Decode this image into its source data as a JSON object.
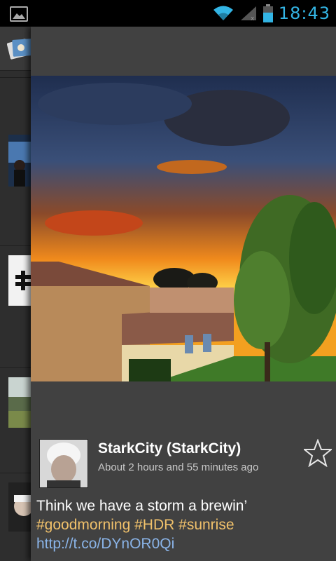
{
  "status_bar": {
    "time": "18:43",
    "icons": [
      "gallery-icon",
      "wifi-icon",
      "signal-icon",
      "battery-icon"
    ],
    "accent_color": "#33b5e5"
  },
  "sidebar": {
    "items": [
      {
        "type": "app-icon"
      },
      {
        "type": "thumbnail"
      },
      {
        "type": "thumbnail"
      },
      {
        "type": "thumbnail"
      },
      {
        "type": "thumbnail"
      }
    ]
  },
  "tweet": {
    "user_display": "StarkCity (StarkCity)",
    "time_ago": "About 2 hours and 55 minutes ago",
    "text_plain": "Think we have a storm a brewin’ ",
    "hashtags": [
      "#goodmorning",
      "#HDR",
      "#sunrise"
    ],
    "link": "http://t.co/DYnOR0Qi",
    "hashtag_color": "#f2c26b",
    "link_color": "#8ab4e8"
  }
}
